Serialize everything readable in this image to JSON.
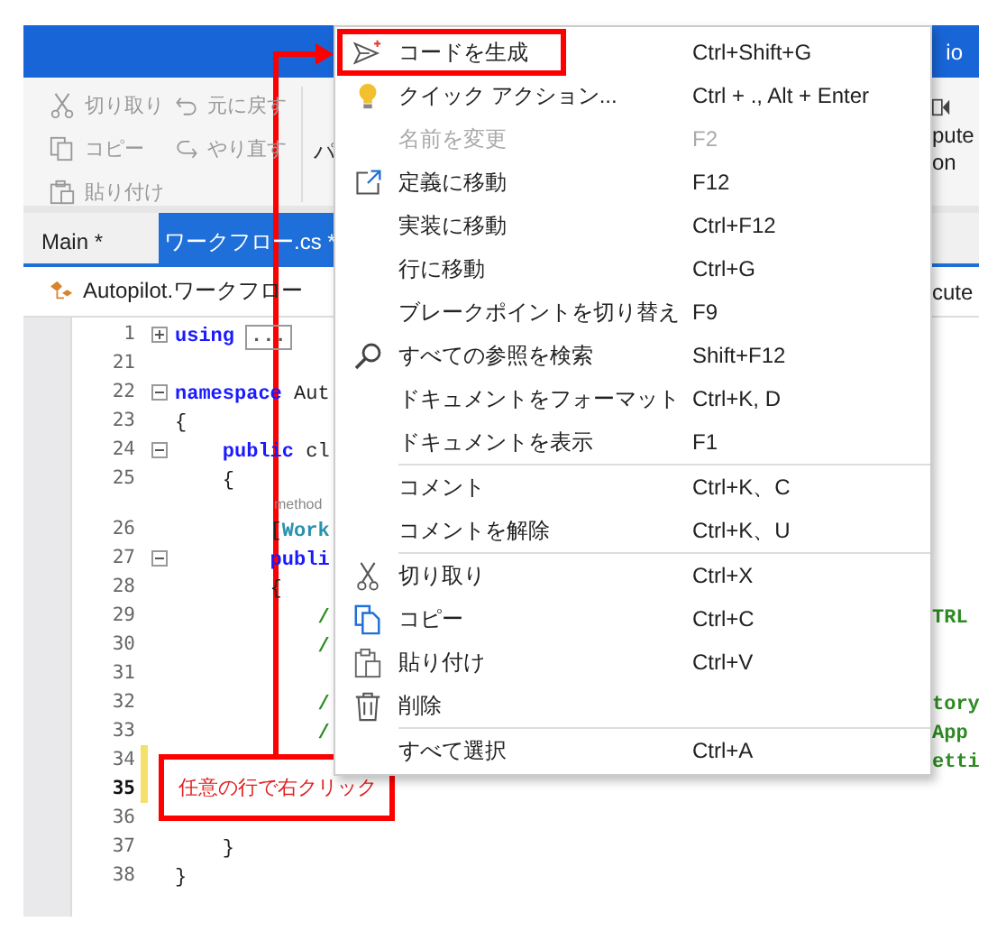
{
  "title_bar": {
    "text_right": "io"
  },
  "ribbon": {
    "clipboard": [
      {
        "label": "切り取り",
        "disabled": true
      },
      {
        "label": "コピー",
        "disabled": true
      },
      {
        "label": "貼り付け",
        "disabled": true
      }
    ],
    "history": [
      {
        "label": "元に戻す",
        "disabled": true
      },
      {
        "label": "やり直す",
        "disabled": true
      }
    ],
    "next_group_label": "パ",
    "right_label_lines": [
      "pute",
      "on"
    ]
  },
  "tabs": [
    {
      "label": "Main *",
      "selected": false
    },
    {
      "label": "ワークフロー.cs *",
      "selected": true
    }
  ],
  "breadcrumb": {
    "path": "Autopilot.ワークフロー",
    "right_text": "cute"
  },
  "editor": {
    "lines": [
      {
        "kind": "code",
        "number": "1",
        "current": false,
        "changed": false,
        "expanded": false,
        "tokens": [
          {
            "kind": "keyword",
            "text": "using"
          },
          {
            "kind": "collapsed",
            "text": "..."
          }
        ]
      },
      {
        "kind": "code",
        "number": "21",
        "current": false,
        "changed": false
      },
      {
        "kind": "code",
        "number": "22",
        "current": false,
        "changed": false,
        "expanded": true,
        "tokens": [
          {
            "kind": "keyword",
            "text": "namespace"
          },
          {
            "kind": "plain",
            "text": " Aut"
          }
        ]
      },
      {
        "kind": "code",
        "number": "23",
        "current": false,
        "changed": false,
        "tokens": [
          {
            "kind": "plain",
            "text": "{"
          }
        ]
      },
      {
        "kind": "code",
        "number": "24",
        "current": false,
        "changed": false,
        "expanded": true,
        "tokens": [
          {
            "kind": "keyword",
            "text": "    public"
          },
          {
            "kind": "plain",
            "text": " cl"
          }
        ]
      },
      {
        "kind": "code",
        "number": "25",
        "current": false,
        "changed": false,
        "tokens": [
          {
            "kind": "plain",
            "text": "    {"
          }
        ]
      },
      {
        "kind": "codelens",
        "text": "method"
      },
      {
        "kind": "code",
        "number": "26",
        "current": false,
        "changed": false,
        "tokens": [
          {
            "kind": "plain",
            "text": "        ["
          },
          {
            "kind": "type",
            "text": "Work"
          }
        ]
      },
      {
        "kind": "code",
        "number": "27",
        "current": false,
        "changed": false,
        "expanded": true,
        "tokens": [
          {
            "kind": "keyword",
            "text": "        publi"
          }
        ]
      },
      {
        "kind": "code",
        "number": "28",
        "current": false,
        "changed": false,
        "tokens": [
          {
            "kind": "plain",
            "text": "        {"
          }
        ]
      },
      {
        "kind": "code",
        "number": "29",
        "current": false,
        "changed": false,
        "tokens": [
          {
            "kind": "comment",
            "text": "            /"
          }
        ],
        "right": [
          {
            "kind": "comment",
            "text": "TRL"
          }
        ]
      },
      {
        "kind": "code",
        "number": "30",
        "current": false,
        "changed": false,
        "tokens": [
          {
            "kind": "comment",
            "text": "            /"
          }
        ]
      },
      {
        "kind": "code",
        "number": "31",
        "current": false,
        "changed": false
      },
      {
        "kind": "code",
        "number": "32",
        "current": false,
        "changed": false,
        "tokens": [
          {
            "kind": "comment",
            "text": "            /"
          }
        ],
        "right": [
          {
            "kind": "comment",
            "text": "tory"
          }
        ]
      },
      {
        "kind": "code",
        "number": "33",
        "current": false,
        "changed": false,
        "tokens": [
          {
            "kind": "comment",
            "text": "            /"
          }
        ],
        "right": [
          {
            "kind": "comment",
            "text": "App"
          }
        ]
      },
      {
        "kind": "code",
        "number": "34",
        "current": false,
        "changed": true,
        "right": [
          {
            "kind": "comment",
            "text": "etti"
          }
        ]
      },
      {
        "kind": "code",
        "number": "35",
        "current": true,
        "changed": true
      },
      {
        "kind": "code",
        "number": "36",
        "current": false,
        "changed": false
      },
      {
        "kind": "code",
        "number": "37",
        "current": false,
        "changed": false,
        "tokens": [
          {
            "kind": "plain",
            "text": "    }"
          }
        ]
      },
      {
        "kind": "code",
        "number": "38",
        "current": false,
        "changed": false,
        "tokens": [
          {
            "kind": "plain",
            "text": "}"
          }
        ]
      }
    ]
  },
  "context_menu": {
    "groups": [
      [
        {
          "label": "コードを生成",
          "shortcut": "Ctrl+Shift+G",
          "disabled": false
        },
        {
          "label": "クイック アクション...",
          "shortcut": "Ctrl + ., Alt + Enter",
          "disabled": false
        },
        {
          "label": "名前を変更",
          "shortcut": "F2",
          "disabled": true
        },
        {
          "label": "定義に移動",
          "shortcut": "F12",
          "disabled": false
        },
        {
          "label": "実装に移動",
          "shortcut": "Ctrl+F12",
          "disabled": false
        },
        {
          "label": "行に移動",
          "shortcut": "Ctrl+G",
          "disabled": false
        },
        {
          "label": "ブレークポイントを切り替え",
          "shortcut": "F9",
          "disabled": false
        },
        {
          "label": "すべての参照を検索",
          "shortcut": "Shift+F12",
          "disabled": false
        },
        {
          "label": "ドキュメントをフォーマット",
          "shortcut": "Ctrl+K, D",
          "disabled": false
        },
        {
          "label": "ドキュメントを表示",
          "shortcut": "F1",
          "disabled": false
        }
      ],
      [
        {
          "label": "コメント",
          "shortcut": "Ctrl+K、C",
          "disabled": false
        },
        {
          "label": "コメントを解除",
          "shortcut": "Ctrl+K、U",
          "disabled": false
        }
      ],
      [
        {
          "label": "切り取り",
          "shortcut": "Ctrl+X",
          "disabled": false
        },
        {
          "label": "コピー",
          "shortcut": "Ctrl+C",
          "disabled": false
        },
        {
          "label": "貼り付け",
          "shortcut": "Ctrl+V",
          "disabled": false
        },
        {
          "label": "削除",
          "disabled": false
        }
      ],
      [
        {
          "label": "すべて選択",
          "shortcut": "Ctrl+A",
          "disabled": false
        }
      ]
    ]
  },
  "annotation": {
    "text": "任意の行で右クリック"
  }
}
